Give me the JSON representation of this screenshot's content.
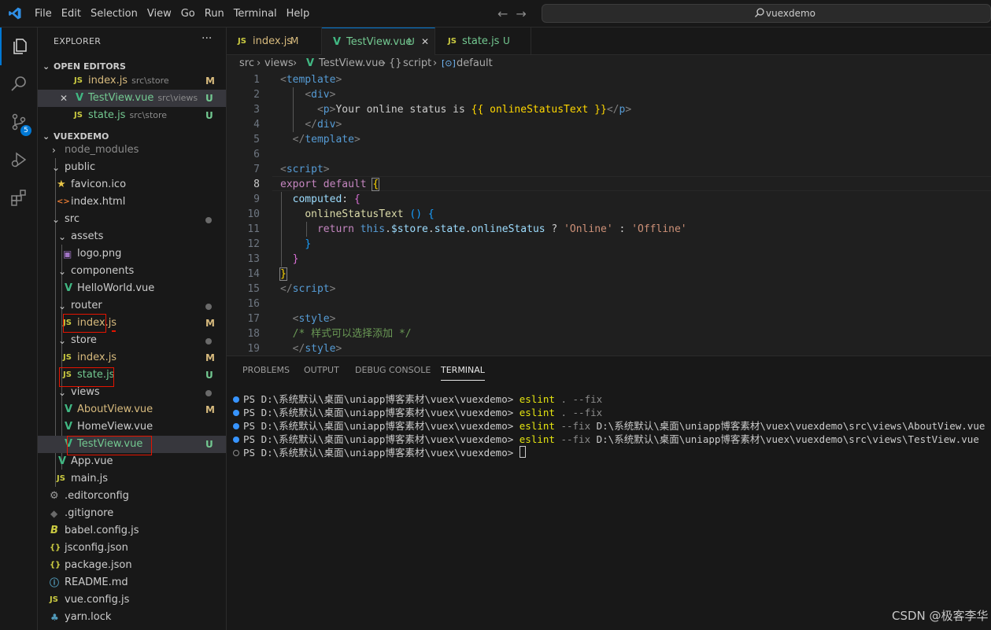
{
  "menu": [
    "File",
    "Edit",
    "Selection",
    "View",
    "Go",
    "Run",
    "Terminal",
    "Help"
  ],
  "search": {
    "text": "vuexdemo"
  },
  "activity": {
    "scm_badge": "5"
  },
  "explorer": {
    "title": "EXPLORER",
    "more": "···",
    "open_editors_label": "OPEN EDITORS",
    "open_editors": [
      {
        "icon": "JS",
        "name": "index.js",
        "path": "src\\store",
        "status": "M"
      },
      {
        "icon": "V",
        "name": "TestView.vue",
        "path": "src\\views",
        "status": "U",
        "close": "✕"
      },
      {
        "icon": "JS",
        "name": "state.js",
        "path": "src\\store",
        "status": "U"
      }
    ],
    "project_label": "VUEXDEMO",
    "tree": [
      {
        "name": "node_modules"
      },
      {
        "name": "public"
      },
      {
        "name": "favicon.ico"
      },
      {
        "name": "index.html",
        "icon": "<>"
      },
      {
        "name": "src"
      },
      {
        "name": "assets"
      },
      {
        "name": "logo.png"
      },
      {
        "name": "components"
      },
      {
        "name": "HelloWorld.vue"
      },
      {
        "name": "router"
      },
      {
        "name": "index.js",
        "icon": "JS",
        "status": "M"
      },
      {
        "name": "store"
      },
      {
        "name": "index.js",
        "icon": "JS",
        "status": "M"
      },
      {
        "name": "state.js",
        "icon": "JS",
        "status": "U"
      },
      {
        "name": "views"
      },
      {
        "name": "AboutView.vue",
        "status": "M"
      },
      {
        "name": "HomeView.vue"
      },
      {
        "name": "TestView.vue",
        "status": "U"
      },
      {
        "name": "App.vue"
      },
      {
        "name": "main.js",
        "icon": "JS"
      },
      {
        "name": ".editorconfig"
      },
      {
        "name": ".gitignore"
      },
      {
        "name": "babel.config.js"
      },
      {
        "name": "jsconfig.json",
        "icon": "{}"
      },
      {
        "name": "package.json",
        "icon": "{}"
      },
      {
        "name": "README.md"
      },
      {
        "name": "vue.config.js",
        "icon": "JS"
      },
      {
        "name": "yarn.lock"
      }
    ]
  },
  "tabs": [
    {
      "icon": "JS",
      "label": "index.js",
      "status": "M"
    },
    {
      "icon": "V",
      "label": "TestView.vue",
      "status": "U",
      "close": "✕"
    },
    {
      "icon": "JS",
      "label": "state.js",
      "status": "U"
    }
  ],
  "breadcrumb": {
    "a": "src",
    "b": "views",
    "c": "TestView.vue",
    "d": "script",
    "d_icon": "{}",
    "e": "default"
  },
  "line_numbers": [
    "1",
    "2",
    "3",
    "4",
    "5",
    "6",
    "7",
    "8",
    "9",
    "10",
    "11",
    "12",
    "13",
    "14",
    "15",
    "16",
    "17",
    "18",
    "19"
  ],
  "code": {
    "l3_text": "Your online status is ",
    "l3_expr": "{{ onlineStatusText }}",
    "l11_online": "'Online'",
    "l11_offline": "'Offline'",
    "l18_comment": "/* 样式可以选择添加 */"
  },
  "panel_tabs": [
    "PROBLEMS",
    "OUTPUT",
    "DEBUG CONSOLE",
    "TERMINAL"
  ],
  "terminal": [
    {
      "prompt": "PS D:\\系统默认\\桌面\\uniapp博客素材\\vuex\\vuexdemo> ",
      "cmd": "eslint",
      "args": " . --fix"
    },
    {
      "prompt": "PS D:\\系统默认\\桌面\\uniapp博客素材\\vuex\\vuexdemo> ",
      "cmd": "eslint",
      "args": " . --fix"
    },
    {
      "prompt": "PS D:\\系统默认\\桌面\\uniapp博客素材\\vuex\\vuexdemo> ",
      "cmd": "eslint",
      "args": " --fix ",
      "path": "D:\\系统默认\\桌面\\uniapp博客素材\\vuex\\vuexdemo\\src\\views\\AboutView.vue"
    },
    {
      "prompt": "PS D:\\系统默认\\桌面\\uniapp博客素材\\vuex\\vuexdemo> ",
      "cmd": "eslint",
      "args": " --fix ",
      "path": "D:\\系统默认\\桌面\\uniapp博客素材\\vuex\\vuexdemo\\src\\views\\TestView.vue"
    },
    {
      "prompt": "PS D:\\系统默认\\桌面\\uniapp博客素材\\vuex\\vuexdemo> "
    }
  ],
  "watermark": "CSDN @极客李华",
  "colors": {
    "accent": "#0078d4",
    "modified": "#d7ba7d",
    "untracked": "#73c991",
    "highlight_box": "#e51400"
  }
}
